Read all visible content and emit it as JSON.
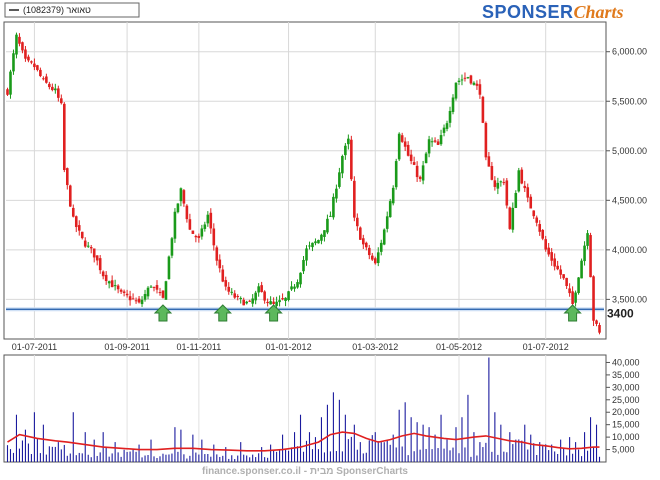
{
  "legend": {
    "label": "טאואר (1082379)"
  },
  "brand": {
    "part1": "SPONSER",
    "part2": "Charts"
  },
  "watermark": "finance.sponser.co.il - מבית SponserCharts",
  "colors": {
    "up": "#1a9a1a",
    "down": "#e02020",
    "level": "#1e5aa8",
    "volume": "#1a1a9e",
    "avg": "#e02020",
    "arrow": "#5cb85c"
  },
  "chart_data": [
    {
      "type": "candlestick",
      "yaxis_side": "right",
      "ylim": [
        3100,
        6300
      ],
      "yticks": [
        3500,
        4000,
        4500,
        5000,
        5500,
        6000
      ],
      "ytick_labels": [
        "3,500.00",
        "4,000.00",
        "4,500.00",
        "5,000.00",
        "5,500.00",
        "6,000.00"
      ],
      "xticks": [
        {
          "day": 9,
          "label": "01-07-2011"
        },
        {
          "day": 40,
          "label": "01-09-2011"
        },
        {
          "day": 64,
          "label": "01-11-2011"
        },
        {
          "day": 94,
          "label": "01-01-2012"
        },
        {
          "day": 123,
          "label": "01-03-2012"
        },
        {
          "day": 151,
          "label": "01-05-2012"
        },
        {
          "day": 180,
          "label": "01-07-2012"
        }
      ],
      "level": {
        "value": 3400,
        "label": "3400"
      },
      "arrows_at_day": [
        52,
        72,
        89,
        189
      ],
      "close_path": [
        [
          0,
          5600
        ],
        [
          3,
          6150
        ],
        [
          6,
          5900
        ],
        [
          9,
          5850
        ],
        [
          12,
          5700
        ],
        [
          16,
          5600
        ],
        [
          18,
          5450
        ],
        [
          19,
          4800
        ],
        [
          22,
          4300
        ],
        [
          25,
          4100
        ],
        [
          29,
          3950
        ],
        [
          32,
          3750
        ],
        [
          35,
          3650
        ],
        [
          38,
          3550
        ],
        [
          42,
          3500
        ],
        [
          44,
          3450
        ],
        [
          48,
          3650
        ],
        [
          52,
          3500
        ],
        [
          56,
          4350
        ],
        [
          58,
          4600
        ],
        [
          61,
          4200
        ],
        [
          64,
          4100
        ],
        [
          67,
          4350
        ],
        [
          70,
          3900
        ],
        [
          73,
          3600
        ],
        [
          77,
          3500
        ],
        [
          81,
          3450
        ],
        [
          84,
          3600
        ],
        [
          87,
          3480
        ],
        [
          89,
          3440
        ],
        [
          93,
          3500
        ],
        [
          97,
          3700
        ],
        [
          100,
          4000
        ],
        [
          104,
          4100
        ],
        [
          108,
          4350
        ],
        [
          112,
          4950
        ],
        [
          114,
          5100
        ],
        [
          116,
          4300
        ],
        [
          119,
          4050
        ],
        [
          123,
          3850
        ],
        [
          126,
          4200
        ],
        [
          129,
          4650
        ],
        [
          131,
          5200
        ],
        [
          134,
          4950
        ],
        [
          138,
          4700
        ],
        [
          141,
          5100
        ],
        [
          144,
          5050
        ],
        [
          147,
          5300
        ],
        [
          150,
          5700
        ],
        [
          154,
          5750
        ],
        [
          158,
          5600
        ],
        [
          160,
          4900
        ],
        [
          163,
          4650
        ],
        [
          166,
          4700
        ],
        [
          168,
          4200
        ],
        [
          171,
          4800
        ],
        [
          174,
          4500
        ],
        [
          177,
          4300
        ],
        [
          180,
          4000
        ],
        [
          183,
          3850
        ],
        [
          186,
          3700
        ],
        [
          189,
          3450
        ],
        [
          192,
          3900
        ],
        [
          194,
          4200
        ],
        [
          196,
          3300
        ],
        [
          198,
          3150
        ]
      ],
      "volume": {
        "ylim": [
          0,
          43000
        ],
        "yticks": [
          5000,
          10000,
          15000,
          20000,
          25000,
          30000,
          35000,
          40000
        ],
        "ytick_labels": [
          "5,000",
          "10,000",
          "15,000",
          "20,000",
          "25,000",
          "30,000",
          "35,000",
          "40,000"
        ],
        "base": [
          9000,
          7500,
          6000,
          5500,
          5000,
          4500,
          4000,
          4000,
          3500,
          3000,
          3500,
          3000,
          2800,
          3000,
          3500,
          4000,
          4500,
          5500,
          7000,
          9000,
          10000,
          8500,
          7000,
          6500,
          6000,
          6000,
          5500,
          5000,
          6000,
          7000,
          9000,
          6500,
          6000,
          5500,
          5000,
          5000
        ],
        "spikes": [
          [
            3,
            19000
          ],
          [
            6,
            13000
          ],
          [
            9,
            20000
          ],
          [
            12,
            15000
          ],
          [
            17,
            8000
          ],
          [
            22,
            20000
          ],
          [
            26,
            12000
          ],
          [
            29,
            9000
          ],
          [
            32,
            12000
          ],
          [
            36,
            8000
          ],
          [
            44,
            7000
          ],
          [
            48,
            9000
          ],
          [
            56,
            14000
          ],
          [
            58,
            13000
          ],
          [
            62,
            11000
          ],
          [
            65,
            9000
          ],
          [
            69,
            7000
          ],
          [
            73,
            6000
          ],
          [
            78,
            8000
          ],
          [
            85,
            6000
          ],
          [
            88,
            7000
          ],
          [
            92,
            11000
          ],
          [
            96,
            12000
          ],
          [
            98,
            19000
          ],
          [
            101,
            12000
          ],
          [
            103,
            10000
          ],
          [
            105,
            18000
          ],
          [
            107,
            23000
          ],
          [
            109,
            28000
          ],
          [
            111,
            25000
          ],
          [
            113,
            19000
          ],
          [
            116,
            15000
          ],
          [
            118,
            8000
          ],
          [
            123,
            12000
          ],
          [
            125,
            8000
          ],
          [
            129,
            11000
          ],
          [
            131,
            21000
          ],
          [
            133,
            24000
          ],
          [
            135,
            18000
          ],
          [
            137,
            16000
          ],
          [
            139,
            15000
          ],
          [
            141,
            14000
          ],
          [
            143,
            11000
          ],
          [
            145,
            19000
          ],
          [
            147,
            9000
          ],
          [
            150,
            14000
          ],
          [
            152,
            18000
          ],
          [
            154,
            27000
          ],
          [
            156,
            12000
          ],
          [
            158,
            8000
          ],
          [
            161,
            42000
          ],
          [
            163,
            20000
          ],
          [
            165,
            15000
          ],
          [
            168,
            12000
          ],
          [
            170,
            9000
          ],
          [
            173,
            15000
          ],
          [
            175,
            11000
          ],
          [
            178,
            8000
          ],
          [
            182,
            7000
          ],
          [
            185,
            9000
          ],
          [
            188,
            10000
          ],
          [
            190,
            8000
          ],
          [
            193,
            12000
          ],
          [
            195,
            18000
          ],
          [
            197,
            15000
          ]
        ],
        "avg": [
          [
            0,
            8000
          ],
          [
            4,
            11000
          ],
          [
            10,
            9500
          ],
          [
            16,
            8500
          ],
          [
            20,
            8000
          ],
          [
            26,
            7000
          ],
          [
            32,
            6000
          ],
          [
            38,
            5500
          ],
          [
            44,
            5000
          ],
          [
            50,
            5000
          ],
          [
            56,
            5500
          ],
          [
            62,
            5500
          ],
          [
            68,
            5000
          ],
          [
            74,
            4800
          ],
          [
            80,
            4500
          ],
          [
            86,
            4500
          ],
          [
            92,
            5000
          ],
          [
            98,
            6000
          ],
          [
            104,
            8000
          ],
          [
            108,
            11000
          ],
          [
            112,
            12000
          ],
          [
            116,
            11500
          ],
          [
            120,
            9500
          ],
          [
            124,
            8000
          ],
          [
            128,
            9000
          ],
          [
            132,
            10500
          ],
          [
            136,
            11500
          ],
          [
            140,
            10500
          ],
          [
            146,
            9500
          ],
          [
            150,
            9000
          ],
          [
            156,
            10000
          ],
          [
            160,
            10500
          ],
          [
            164,
            9500
          ],
          [
            168,
            8500
          ],
          [
            172,
            8000
          ],
          [
            176,
            7000
          ],
          [
            180,
            6500
          ],
          [
            184,
            5800
          ],
          [
            188,
            5300
          ],
          [
            192,
            5500
          ],
          [
            196,
            6000
          ],
          [
            198,
            6000
          ]
        ]
      }
    }
  ]
}
